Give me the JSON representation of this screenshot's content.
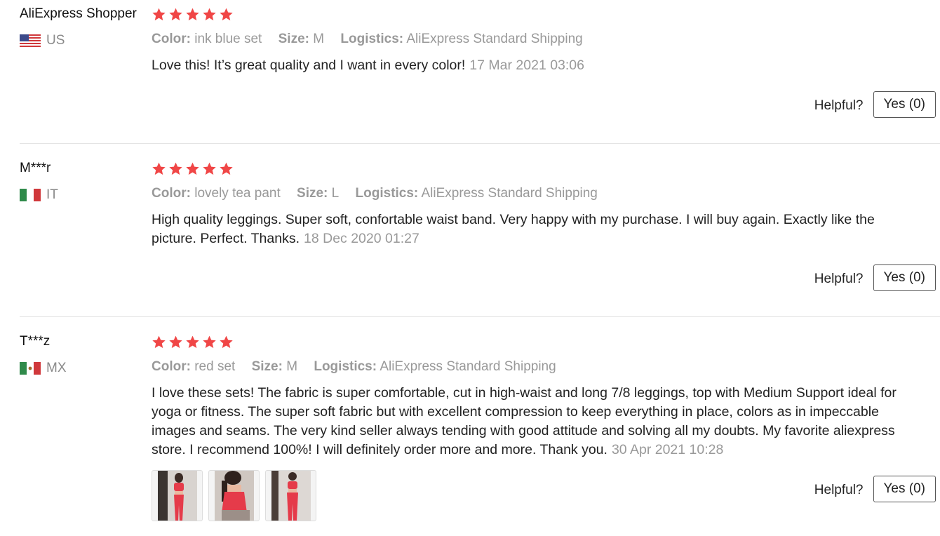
{
  "labels": {
    "color": "Color:",
    "size": "Size:",
    "logistics": "Logistics:",
    "helpful": "Helpful?"
  },
  "colors": {
    "star": "#f04646",
    "meta_text": "#999999",
    "body_text": "#222222"
  },
  "reviews": [
    {
      "user": "AliExpress Shopper",
      "country": "US",
      "flag_icon": "us-flag-icon",
      "rating": 5,
      "color": "ink blue set",
      "size": "M",
      "logistics": "AliExpress Standard Shipping",
      "text": "Love this! It’s great quality and I want in every color!",
      "date": "17 Mar 2021 03:06",
      "helpful_button": "Yes (0)"
    },
    {
      "user": "M***r",
      "country": "IT",
      "flag_icon": "it-flag-icon",
      "rating": 5,
      "color": "lovely tea pant",
      "size": "L",
      "logistics": "AliExpress Standard Shipping",
      "text": "High quality leggings. Super soft, confortable waist band. Very happy with my purchase. I will buy again. Exactly like the picture. Perfect. Thanks.",
      "date": "18 Dec 2020 01:27",
      "helpful_button": "Yes (0)"
    },
    {
      "user": "T***z",
      "country": "MX",
      "flag_icon": "mx-flag-icon",
      "rating": 5,
      "color": "red set",
      "size": "M",
      "logistics": "AliExpress Standard Shipping",
      "text": "I love these sets! The fabric is super comfortable, cut in high-waist and long 7/8 leggings, top with Medium Support ideal for yoga or fitness. The super soft fabric but with excellent compression to keep everything in place, colors as in impeccable images and seams. The very kind seller always tending with good attitude and solving all my doubts. My favorite aliexpress store. I recommend 100%! I will definitely order more and more. Thank you.",
      "date": "30 Apr 2021 10:28",
      "helpful_button": "Yes (0)",
      "photos": [
        "review-photo-1",
        "review-photo-2",
        "review-photo-3"
      ]
    }
  ]
}
